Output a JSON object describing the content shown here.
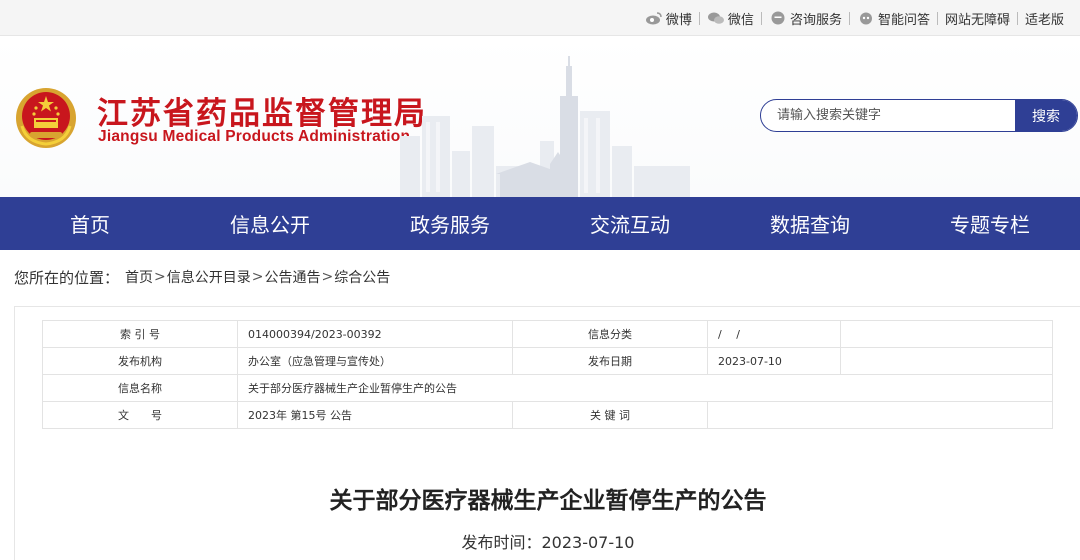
{
  "topbar": {
    "links": [
      {
        "label": "微博",
        "icon": "weibo-icon"
      },
      {
        "label": "微信",
        "icon": "wechat-icon"
      },
      {
        "label": "咨询服务",
        "icon": "chat-bubble-icon"
      },
      {
        "label": "智能问答",
        "icon": "robot-icon"
      },
      {
        "label": "网站无障碍",
        "icon": ""
      },
      {
        "label": "适老版",
        "icon": ""
      }
    ]
  },
  "header": {
    "title_cn": "江苏省药品监督管理局",
    "title_en": "Jiangsu Medical Products Administration",
    "brand_color": "#c8161d"
  },
  "search": {
    "placeholder": "请输入搜索关键字",
    "button_label": "搜索"
  },
  "nav": {
    "color": "#2f3f95",
    "items": [
      "首页",
      "信息公开",
      "政务服务",
      "交流互动",
      "数据查询",
      "专题专栏"
    ]
  },
  "breadcrumb": {
    "label": "您所在的位置：",
    "items": [
      "首页",
      "信息公开目录",
      "公告通告",
      "综合公告"
    ],
    "separator": ">"
  },
  "meta": {
    "rows": [
      [
        "索 引 号",
        "014000394/2023-00392",
        "信息分类",
        "/　 /",
        ""
      ],
      [
        "发布机构",
        "办公室（应急管理与宣传处）",
        "发布日期",
        "2023-07-10",
        ""
      ],
      [
        "信息名称",
        "关于部分医疗器械生产企业暂停生产的公告"
      ],
      [
        "文　　号",
        "2023年 第15号 公告",
        "关 键 词",
        ""
      ]
    ]
  },
  "article": {
    "title": "关于部分医疗器械生产企业暂停生产的公告",
    "date": "发布时间：2023-07-10"
  }
}
